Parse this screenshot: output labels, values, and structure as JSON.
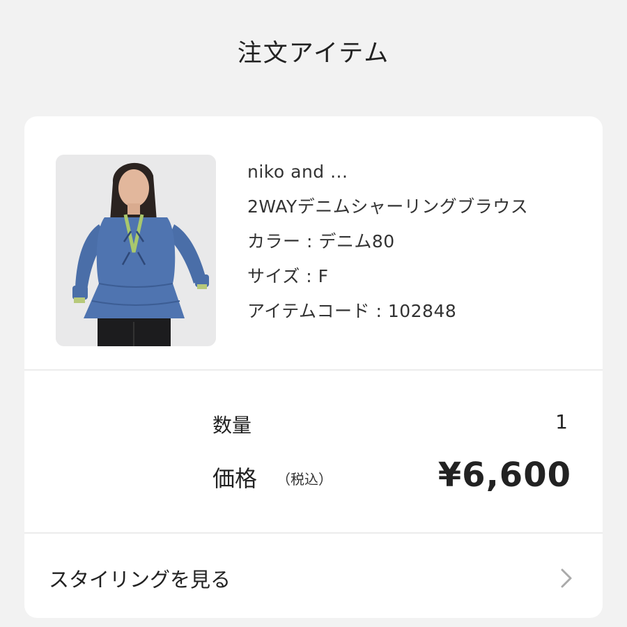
{
  "header": {
    "title": "注文アイテム"
  },
  "item": {
    "image_alt": "2WAYデニムシャーリングブラウス",
    "brand": "niko and ...",
    "name": "2WAYデニムシャーリングブラウス",
    "color_line": "カラー : デニム80",
    "size_line": "サイズ : F",
    "code_line": "アイテムコード : 102848"
  },
  "summary": {
    "quantity_label": "数量",
    "quantity_value": "1",
    "price_label": "価格",
    "tax_note": "（税込）",
    "price_value": "¥6,600"
  },
  "styling": {
    "label": "スタイリングを見る",
    "icon": "chevron-right-icon"
  },
  "colors": {
    "background": "#f2f2f2",
    "card": "#ffffff",
    "text": "#222222",
    "chevron": "#aaaaaa"
  }
}
